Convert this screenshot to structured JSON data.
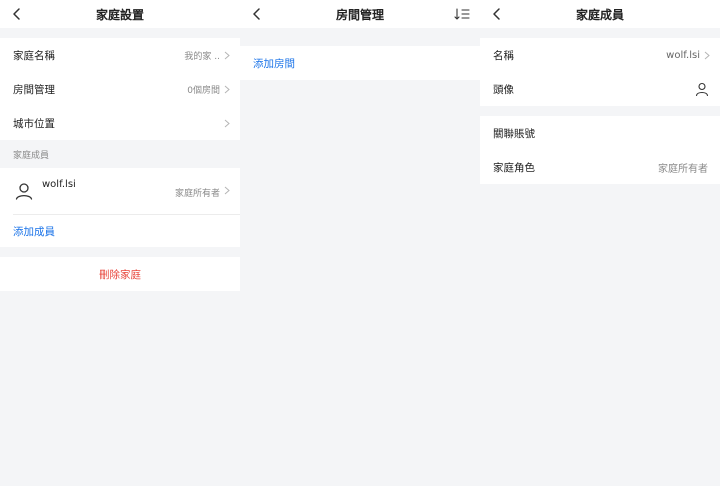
{
  "home_settings": {
    "title": "家庭設置",
    "rows": [
      {
        "label": "家庭名稱",
        "value": "我的家 .."
      },
      {
        "label": "房間管理",
        "value": "0個房間"
      },
      {
        "label": "城市位置",
        "value": ""
      }
    ],
    "members_header": "家庭成員",
    "member": {
      "name": "wolf.lsi",
      "role": "家庭所有者"
    },
    "add_member": "添加成員",
    "delete_home": "刪除家庭"
  },
  "room_management": {
    "title": "房間管理",
    "add_room": "添加房間"
  },
  "member_detail": {
    "title": "家庭成員",
    "rows": [
      {
        "label": "名稱",
        "value": "wolf.lsi"
      },
      {
        "label": "頭像"
      }
    ],
    "rows2": [
      {
        "label": "關聯賬號"
      },
      {
        "label": "家庭角色",
        "value": "家庭所有者"
      }
    ]
  },
  "colors": {
    "link": "#1a73e8",
    "danger": "#e8453c",
    "background": "#f4f5f7"
  }
}
